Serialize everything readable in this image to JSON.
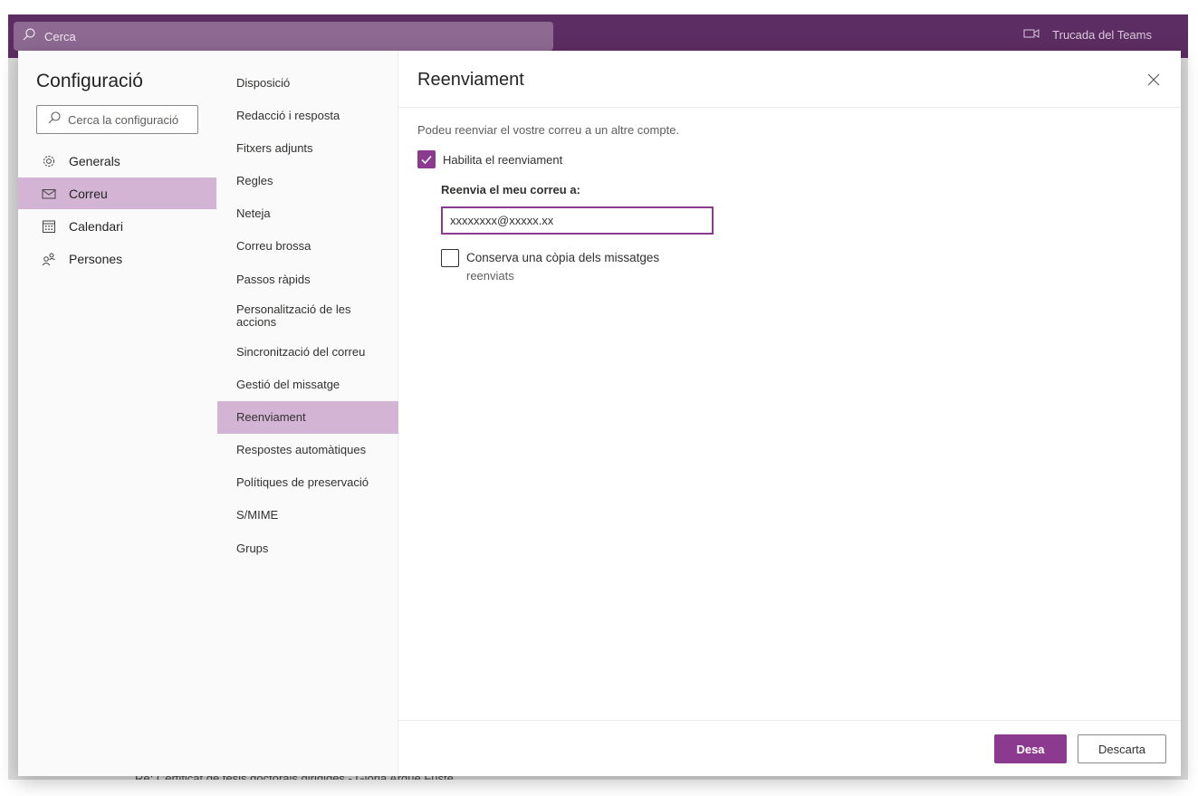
{
  "topbar": {
    "search_placeholder": "Cerca",
    "teams_label": "Trucada del Teams"
  },
  "background": {
    "footer_text": "Re: Certificat de tesis doctorals dirigides - Gloria Arque Fuste"
  },
  "settings": {
    "title": "Configuració",
    "search_placeholder": "Cerca la configuració",
    "categories": [
      {
        "label": "Generals",
        "icon": "gear-icon"
      },
      {
        "label": "Correu",
        "icon": "mail-icon",
        "active": true
      },
      {
        "label": "Calendari",
        "icon": "calendar-icon"
      },
      {
        "label": "Persones",
        "icon": "people-icon"
      }
    ],
    "mail_sections": [
      "Disposició",
      "Redacció i resposta",
      "Fitxers adjunts",
      "Regles",
      "Neteja",
      "Correu brossa",
      "Passos ràpids",
      "Personalització de les accions",
      "Sincronització del correu",
      "Gestió del missatge",
      "Reenviament",
      "Respostes automàtiques",
      "Polítiques de preservació",
      "S/MIME",
      "Grups"
    ],
    "active_section": "Reenviament"
  },
  "panel": {
    "title": "Reenviament",
    "description": "Podeu reenviar el vostre correu a un altre compte.",
    "enable_label": "Habilita el reenviament",
    "enable_checked": true,
    "forward_to_label": "Reenvia el meu correu a:",
    "forward_to_value": "xxxxxxxx@xxxxx.xx",
    "keep_copy_label_line1": "Conserva una còpia dels missatges",
    "keep_copy_label_line2": "reenviats",
    "keep_copy_checked": false,
    "save_label": "Desa",
    "discard_label": "Descarta"
  },
  "colors": {
    "accent": "#8b3a8f",
    "selection": "#d4b4d4",
    "topbar": "#5c2d62"
  }
}
